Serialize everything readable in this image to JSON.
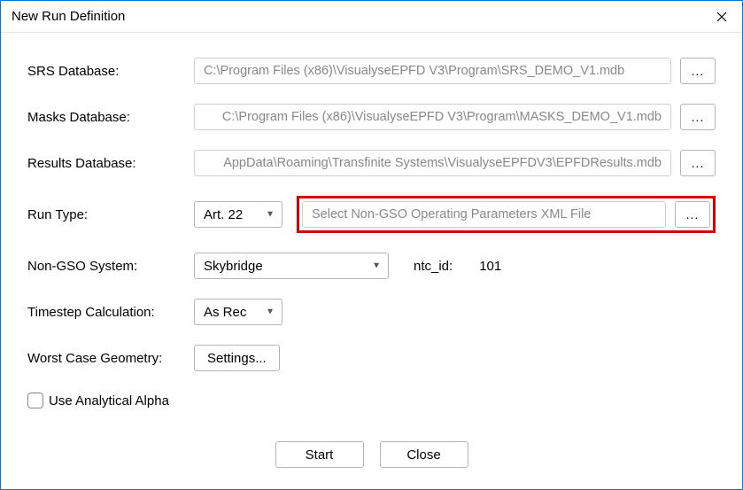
{
  "window": {
    "title": "New Run Definition"
  },
  "labels": {
    "srs": "SRS Database:",
    "masks": "Masks Database:",
    "results": "Results Database:",
    "runtype": "Run Type:",
    "ngso": "Non-GSO System:",
    "timestep": "Timestep Calculation:",
    "wcg": "Worst Case Geometry:",
    "analytical": "Use Analytical Alpha",
    "ntc": "ntc_id:"
  },
  "paths": {
    "srs": "C:\\Program Files (x86)\\VisualyseEPFD V3\\Program\\SRS_DEMO_V1.mdb",
    "masks": "C:\\Program Files (x86)\\VisualyseEPFD V3\\Program\\MASKS_DEMO_V1.mdb",
    "results": "AppData\\Roaming\\Transfinite Systems\\VisualyseEPFDV3\\EPFDResults.mdb",
    "xml_placeholder": "Select Non-GSO Operating Parameters XML File"
  },
  "selects": {
    "runtype": "Art. 22",
    "ngso": "Skybridge",
    "timestep": "As Rec"
  },
  "values": {
    "ntc_id": "101"
  },
  "buttons": {
    "browse": "...",
    "settings": "Settings...",
    "start": "Start",
    "close": "Close"
  }
}
